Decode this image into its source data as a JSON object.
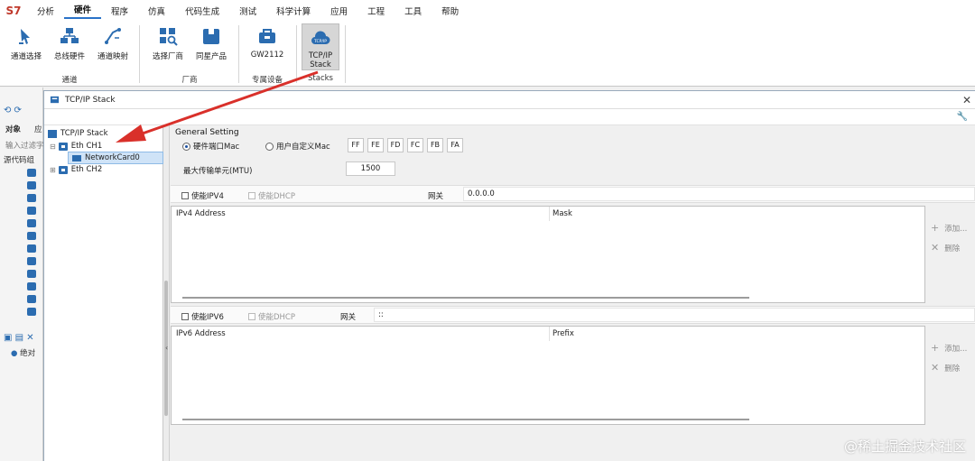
{
  "menubar": {
    "logo": "S7",
    "items": [
      "分析",
      "硬件",
      "程序",
      "仿真",
      "代码生成",
      "测试",
      "科学计算",
      "应用",
      "工程",
      "工具",
      "帮助"
    ],
    "active": "硬件"
  },
  "ribbon": {
    "buttons": [
      {
        "label": "通道选择",
        "icon": "channel-select-icon"
      },
      {
        "label": "总线硬件",
        "icon": "bus-hardware-icon"
      },
      {
        "label": "通道映射",
        "icon": "channel-mapping-icon"
      },
      {
        "label": "选择厂商",
        "icon": "select-vendor-icon"
      },
      {
        "label": "同星产品",
        "icon": "tosun-product-icon"
      },
      {
        "label": "GW2112",
        "icon": "gateway-icon"
      },
      {
        "label": "TCP/IP Stack",
        "icon": "tcpip-cloud-icon"
      }
    ],
    "groups": [
      "通道",
      "厂商",
      "专属设备",
      "Stacks"
    ]
  },
  "background_panel": {
    "tab_object": "对象",
    "tab_app": "应",
    "filter_placeholder": "输入过滤字",
    "tree_root": "源代码组",
    "absolute_label": "绝对"
  },
  "dialog": {
    "title": "TCP/IP Stack",
    "tree": {
      "root": "TCP/IP Stack",
      "eth1": "Eth CH1",
      "card": "NetworkCard0",
      "eth2": "Eth CH2"
    },
    "general": {
      "title": "General Setting",
      "radio_hw": "硬件端口Mac",
      "radio_custom": "用户自定义Mac",
      "mac_bytes": [
        "FF",
        "FE",
        "FD",
        "FC",
        "FB",
        "FA"
      ],
      "mtu_label": "最大传输单元(MTU)",
      "mtu_value": "1500"
    },
    "ipv4": {
      "enable": "使能IPV4",
      "dhcp": "使能DHCP",
      "gateway_label": "网关",
      "gateway_value": "0.0.0.0",
      "col_address": "IPv4 Address",
      "col_mask": "Mask"
    },
    "ipv6": {
      "enable": "使能IPV6",
      "dhcp": "使能DHCP",
      "gateway_label": "网关",
      "gateway_value": "::",
      "col_address": "IPv6 Address",
      "col_prefix": "Prefix"
    },
    "actions": {
      "add": "添加...",
      "delete": "删除"
    }
  },
  "watermark": "@稀土掘金技术社区",
  "colors": {
    "accent": "#2a72c8",
    "arrow": "#d9302a",
    "selection": "#cfe3f7"
  }
}
